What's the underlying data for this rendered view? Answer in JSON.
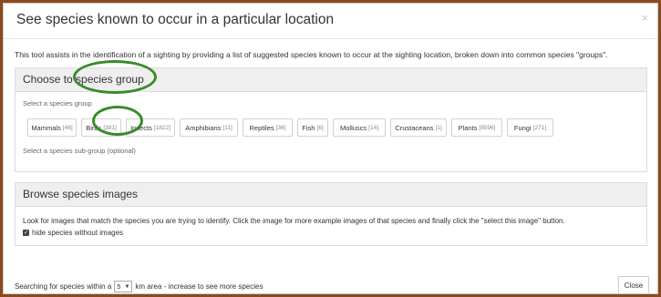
{
  "modal": {
    "title": "See species known to occur in a particular location",
    "close_icon": "×",
    "intro": "This tool assists in the identification of a sighting by providing a list of suggested species known to occur at the sighting location, broken down into common species \"groups\"."
  },
  "group_panel": {
    "title": "Choose to species group",
    "select_label": "Select a species group",
    "subgroup_label": "Select a species sub-group (optional)",
    "groups": [
      {
        "name": "Mammals",
        "count": "[46]"
      },
      {
        "name": "Birds",
        "count": "[381]"
      },
      {
        "name": "Insects",
        "count": "[1822]"
      },
      {
        "name": "Amphibians",
        "count": "[11]"
      },
      {
        "name": "Reptiles",
        "count": "[36]"
      },
      {
        "name": "Fish",
        "count": "[6]"
      },
      {
        "name": "Molluscs",
        "count": "[14]"
      },
      {
        "name": "Crustaceans",
        "count": "[1]"
      },
      {
        "name": "Plants",
        "count": "[8596]"
      },
      {
        "name": "Fungi",
        "count": "[271]"
      }
    ]
  },
  "images_panel": {
    "title": "Browse species images",
    "description": "Look for images that match the species you are trying to identify. Click the image for more example images of that species and finally click the \"select this image\" button.",
    "hide_checkbox_label": "hide species without images"
  },
  "footer": {
    "prefix": "Searching for species within a",
    "radius_value": "5",
    "suffix": "km area - increase to see more species",
    "close_label": "Close"
  },
  "colors": {
    "highlight_oval": "#3a8a2c",
    "background": "#8c4a1c"
  }
}
